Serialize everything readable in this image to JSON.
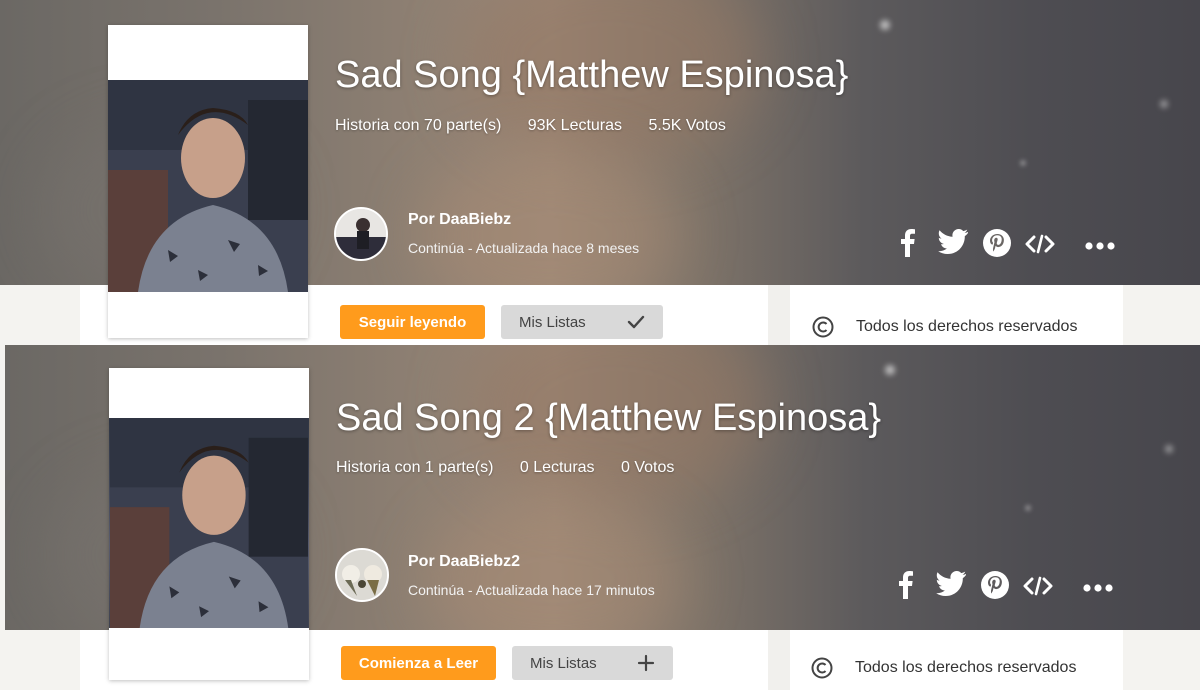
{
  "stories": [
    {
      "title": "Sad Song {Matthew Espinosa}",
      "stats": {
        "parts": "Historia con 70 parte(s)",
        "reads": "93K Lecturas",
        "votes": "5.5K Votos"
      },
      "author": "Por DaaBiebz",
      "status": "Continúa - Actualizada hace 8 meses",
      "primary_button": "Seguir leyendo",
      "list_button": {
        "label": "Mis Listas",
        "icon": "check-icon"
      },
      "rights": "Todos los derechos reservados"
    },
    {
      "title": "Sad Song 2 {Matthew Espinosa}",
      "stats": {
        "parts": "Historia con 1 parte(s)",
        "reads": "0 Lecturas",
        "votes": "0 Votos"
      },
      "author": "Por DaaBiebz2",
      "status": "Continúa - Actualizada hace 17 minutos",
      "primary_button": "Comienza a Leer",
      "list_button": {
        "label": "Mis Listas",
        "icon": "plus-icon"
      },
      "rights": "Todos los derechos reservados"
    }
  ],
  "share_icons": [
    "facebook-icon",
    "twitter-icon",
    "pinterest-icon",
    "embed-code-icon",
    "more-options-icon"
  ],
  "colors": {
    "primary": "#ff9b1c",
    "list_button_bg": "#d9d9d9"
  }
}
